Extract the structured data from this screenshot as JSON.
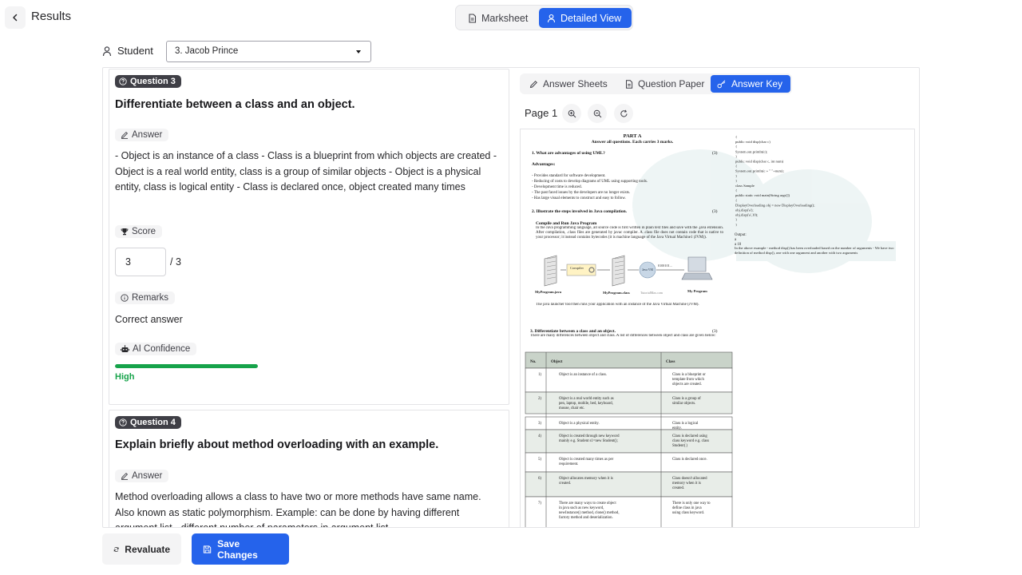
{
  "header": {
    "back_label": "Results",
    "views": [
      {
        "label": "Marksheet",
        "active": false
      },
      {
        "label": "Detailed View",
        "active": true
      }
    ]
  },
  "student": {
    "label": "Student",
    "selected": "3. Jacob Prince"
  },
  "questions": [
    {
      "badge": "Question 3",
      "title": "Differentiate between a class and an object.",
      "answer_label": "Answer",
      "answer": "- Object is an instance of a class - Class is a blueprint from which objects are created - Object is a real world entity, class is a group of similar objects - Object is a physical entity, class is logical entity - Class is declared once, object created many times",
      "score_label": "Score",
      "score": "3",
      "score_max": "/ 3",
      "remarks_label": "Remarks",
      "remarks": "Correct answer",
      "confidence_label": "AI Confidence",
      "confidence_level": "High",
      "confidence_fraction": 1.0
    },
    {
      "badge": "Question 4",
      "title": "Explain briefly about method overloading with an example.",
      "answer_label": "Answer",
      "answer": "Method overloading allows a class to have two or more methods have same name. Also known as static polymorphism. Example: can be done by having different argument list - different number of parameters in argument list"
    }
  ],
  "viewer": {
    "tabs": [
      {
        "label": "Answer Sheets",
        "active": false
      },
      {
        "label": "Question Paper",
        "active": false
      },
      {
        "label": "Answer Key",
        "active": true
      }
    ],
    "page_label": "Page 1",
    "doc": {
      "part": "PART A",
      "instructions": "Answer all questions. Each carries 3 marks.",
      "q1": "1.   What are advantages of using UML?",
      "marks": "(3)",
      "advantages_heading": "Advantages:",
      "advantages": [
        "- Provides standard for software development.",
        "- Reducing of costs to develop diagrams of UML using supporting tools.",
        "- Development time is reduced.",
        "- The past faced issues by the developers are no longer exists.",
        "- Has large visual elements to construct and easy to follow."
      ],
      "q2": "2.  Illustrate the steps involved in Java compilation.",
      "compile_heading": "Compile and Run Java Program",
      "compile_text": "In the Java programming language, all source code is first written in plain text files and save with the .java extension. After compilation, .class files are generated by javac compiler. A .class file does not contain code that is native to your processor; it instead contains bytecodes (it is machine language of the Java Virtual Machine1 (JVM)).",
      "diagram_labels": [
        "MyProgram.java",
        "Compiler",
        "MyProgram.class",
        "Java VM",
        "0100101...",
        "TutorialMax.com",
        "My Program"
      ],
      "launcher_text": "The java launcher tool then runs your application with an instance of the Java Virtual Machine (JVM).",
      "q3": "3.  Differentiate between a class and an object.",
      "q3_intro": "There are many differences between object and class. A list of differences between object and class are given below:",
      "table_headers": [
        "No.",
        "Object",
        "Class"
      ],
      "table_rows": [
        [
          "1)",
          "Object is an instance of a class.",
          "Class is a blueprint or template from which objects are created."
        ],
        [
          "2)",
          "Object is a real world entity such as pen, laptop, mobile, bed, keyboard, mouse, chair etc.",
          "Class is a group of similar objects."
        ],
        [
          "3)",
          "Object is a physical entity.",
          "Class is a logical entity."
        ],
        [
          "4)",
          "Object is created through new keyword mainly e.g. Student s1=new Student();",
          "Class is declared using class keyword e.g. class Student{}"
        ],
        [
          "5)",
          "Object is created many times as per requirement.",
          "Class is declared once."
        ],
        [
          "6)",
          "Object allocates memory when it is created.",
          "Class doesn't allocated memory when it is created."
        ],
        [
          "7)",
          "There are many ways to create object in java such as new keyword, newInstance() method, clone() method, factory method and deserialization.",
          "There is only one way to define class in java using class keyword."
        ]
      ],
      "code_lines": [
        "{",
        "  public void disp(char c)",
        "  {",
        "    System.out.println(c);",
        "  }",
        "  public void disp(char c, int num)",
        "  {",
        "    System.out.println(c + \" \"+num);",
        "  }",
        "}",
        "class Sample",
        "{",
        "  public static void main(String args[])",
        "  {",
        "    DisplayOverloading obj = new DisplayOverloading();",
        "    obj.disp('a');",
        "    obj.disp('a',10);",
        "  }",
        "}"
      ],
      "output_label": "Output:",
      "output_values": [
        "a",
        "a 10"
      ],
      "overload_note": "In the above example - method disp() has been overloaded based on the number of arguments - We have two definition of method disp(), one with one argument and another with two arguments"
    }
  },
  "actions": {
    "revaluate": "Revaluate",
    "save": "Save Changes"
  },
  "colors": {
    "accent": "#2563eb",
    "confidence": "#16a34a",
    "badge": "#3f3f46"
  }
}
